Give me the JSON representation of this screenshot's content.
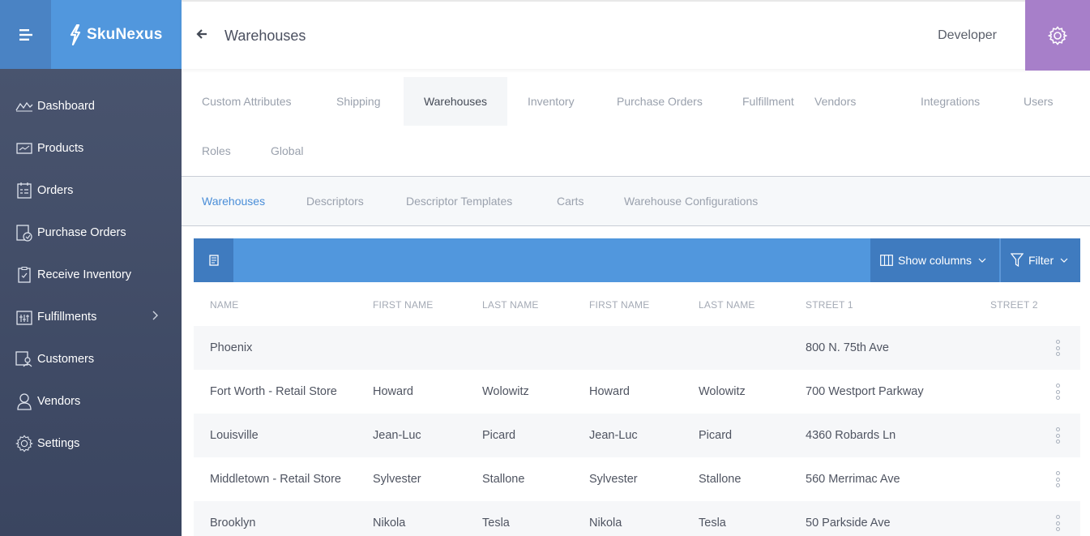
{
  "brand": {
    "name": "SkuNexus"
  },
  "sidebar": {
    "items": [
      {
        "label": "Dashboard",
        "icon": "dashboard-icon"
      },
      {
        "label": "Products",
        "icon": "products-icon"
      },
      {
        "label": "Orders",
        "icon": "orders-icon"
      },
      {
        "label": "Purchase Orders",
        "icon": "purchase-orders-icon"
      },
      {
        "label": "Receive Inventory",
        "icon": "clipboard-icon"
      },
      {
        "label": "Fulfillments",
        "icon": "fulfillments-icon"
      },
      {
        "label": "Customers",
        "icon": "customers-icon"
      },
      {
        "label": "Vendors",
        "icon": "vendors-icon"
      },
      {
        "label": "Settings",
        "icon": "gear-icon"
      }
    ]
  },
  "header": {
    "title": "Warehouses",
    "role": "Developer"
  },
  "tabs": [
    "Custom Attributes",
    "Shipping",
    "Warehouses",
    "Inventory",
    "Purchase Orders",
    "Fulfillment",
    "Vendors",
    "Integrations",
    "Users",
    "Roles",
    "Global"
  ],
  "subtabs": [
    "Warehouses",
    "Descriptors",
    "Descriptor Templates",
    "Carts",
    "Warehouse Configurations"
  ],
  "toolbar": {
    "show_columns": "Show columns",
    "filter": "Filter"
  },
  "table": {
    "columns": [
      "NAME",
      "FIRST NAME",
      "LAST NAME",
      "FIRST NAME",
      "LAST NAME",
      "STREET 1",
      "STREET 2"
    ],
    "rows": [
      [
        "Phoenix",
        "",
        "",
        "",
        "",
        "800 N. 75th Ave",
        ""
      ],
      [
        "Fort Worth - Retail Store",
        "Howard",
        "Wolowitz",
        "Howard",
        "Wolowitz",
        "700 Westport Parkway",
        ""
      ],
      [
        "Louisville",
        "Jean-Luc",
        "Picard",
        "Jean-Luc",
        "Picard",
        "4360 Robards Ln",
        ""
      ],
      [
        "Middletown - Retail Store",
        "Sylvester",
        "Stallone",
        "Sylvester",
        "Stallone",
        "560 Merrimac Ave",
        ""
      ],
      [
        "Brooklyn",
        "Nikola",
        "Tesla",
        "Nikola",
        "Tesla",
        "50 Parkside Ave",
        ""
      ]
    ]
  },
  "colors": {
    "sidebar": "#46516b",
    "brand": "#5197dd",
    "settings": "#a77fc9",
    "accent": "#4a8ed8"
  }
}
